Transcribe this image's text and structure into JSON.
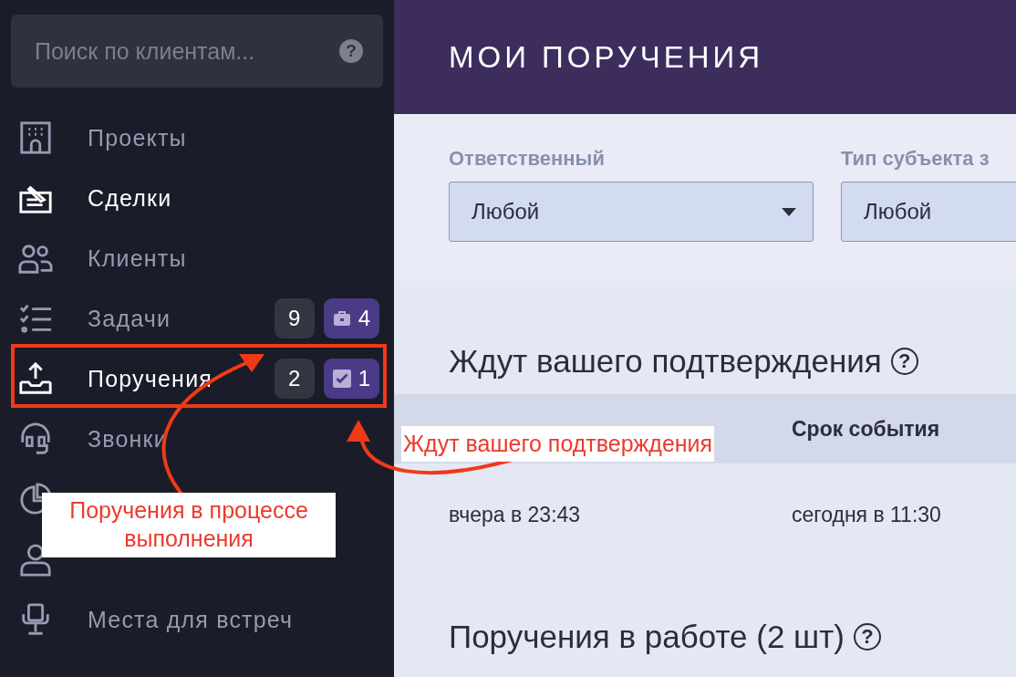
{
  "sidebar": {
    "search": {
      "placeholder": "Поиск по клиентам...",
      "help": "?"
    },
    "items": [
      {
        "label": "Проекты",
        "selected": false
      },
      {
        "label": "Сделки",
        "selected": true
      },
      {
        "label": "Клиенты",
        "selected": false
      },
      {
        "label": "Задачи",
        "selected": false,
        "badges": [
          {
            "kind": "plain",
            "text": "9"
          },
          {
            "kind": "briefcase",
            "text": "4"
          }
        ]
      },
      {
        "label": "Поручения",
        "selected": true,
        "badges": [
          {
            "kind": "plain",
            "text": "2"
          },
          {
            "kind": "check",
            "text": "1"
          }
        ]
      },
      {
        "label": "Звонки",
        "selected": false
      },
      {
        "selected": false
      },
      {
        "selected": false
      },
      {
        "label": "Места для встреч",
        "selected": false
      }
    ]
  },
  "header": {
    "title": "МОИ ПОРУЧЕНИЯ"
  },
  "filters": [
    {
      "label": "Ответственный",
      "value": "Любой"
    },
    {
      "label": "Тип субъекта з",
      "value": "Любой"
    }
  ],
  "sections": [
    {
      "title": "Ждут вашего подтверждения",
      "help": "?",
      "columns": [
        "",
        "Срок события"
      ],
      "rows": [
        [
          "вчера в 23:43",
          "сегодня в 11:30"
        ]
      ]
    },
    {
      "title": "Поручения в работе (2 шт)",
      "help": "?"
    }
  ],
  "annotations": [
    {
      "text": "Поручения в процессе выполнения"
    },
    {
      "text": "Ждут вашего подтверждения"
    }
  ]
}
